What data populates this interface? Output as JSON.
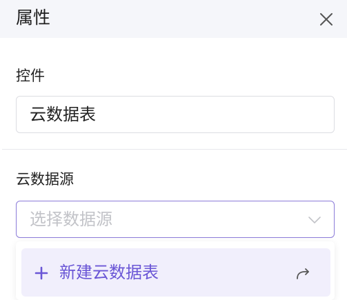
{
  "header": {
    "title": "属性",
    "close_icon": "close-icon"
  },
  "control_section": {
    "label": "控件",
    "value": "云数据表"
  },
  "source_section": {
    "label": "云数据源",
    "placeholder": "选择数据源",
    "chevron_icon": "chevron-down-icon"
  },
  "dropdown": {
    "create_item": {
      "icon": "plus-icon",
      "label": "新建云数据表",
      "trailing_icon": "redirect-arrow-icon"
    }
  },
  "colors": {
    "accent": "#6a56d6",
    "accent_bg": "#f1effc",
    "header_bg": "#f5f6fa",
    "focus_border": "#8b7bd8"
  }
}
